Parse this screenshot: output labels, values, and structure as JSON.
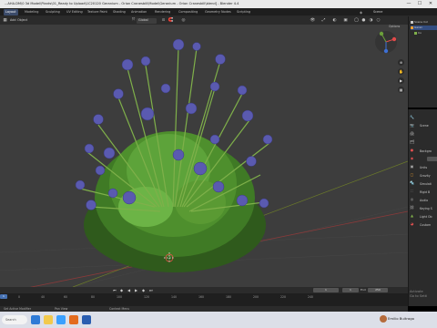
{
  "window": {
    "title": "...AHA.DM\\0 3d Model\\Plants\\01_Ready to Upload\\1C20120 Geranium - Orion Cranesbill\\Model\\Geranium - Orion Cranesbill\\blend] - Blender 4.4",
    "minimize": "—",
    "maximize": "☐",
    "close": "✕"
  },
  "tabs": [
    {
      "label": "Layout",
      "active": true
    },
    {
      "label": "Modeling",
      "active": false
    },
    {
      "label": "Sculpting",
      "active": false
    },
    {
      "label": "UV Editing",
      "active": false
    },
    {
      "label": "Texture Paint",
      "active": false
    },
    {
      "label": "Shading",
      "active": false
    },
    {
      "label": "Animation",
      "active": false
    },
    {
      "label": "Rendering",
      "active": false
    },
    {
      "label": "Compositing",
      "active": false
    },
    {
      "label": "Geometry Nodes",
      "active": false
    },
    {
      "label": "Scripting",
      "active": false
    }
  ],
  "scene_label": "Scene",
  "viewport_header": {
    "add": "Add",
    "object": "Object",
    "transform": "Global",
    "options": "Options"
  },
  "outliner": {
    "rows": [
      "Scene Col",
      "Geran",
      "Co"
    ]
  },
  "properties": {
    "rows": [
      "Scene",
      "Backgro",
      "Units",
      "Gravity",
      "Simulati",
      "Rigid B",
      "Audio",
      "Keying S",
      "Light Ob",
      "Custom"
    ]
  },
  "timeline": {
    "current_frame": "1",
    "start": "1",
    "end_label": "End",
    "end": "250",
    "ticks": [
      "0",
      "40",
      "60",
      "80",
      "100",
      "120",
      "140",
      "160",
      "180",
      "200",
      "220",
      "240"
    ]
  },
  "activate": {
    "line1": "Activate",
    "line2": "Go to Setti"
  },
  "status": {
    "left": "Set Active Modifier",
    "middle": "Pan View",
    "right": "Context Menu"
  },
  "taskbar": {
    "search": "Search",
    "user": "Emilio Buitrago"
  },
  "colors": {
    "accent": "#4772b3",
    "viewport": "#3d3d3d",
    "flower": "#5a5ab0",
    "foliage": "#5da33a"
  }
}
